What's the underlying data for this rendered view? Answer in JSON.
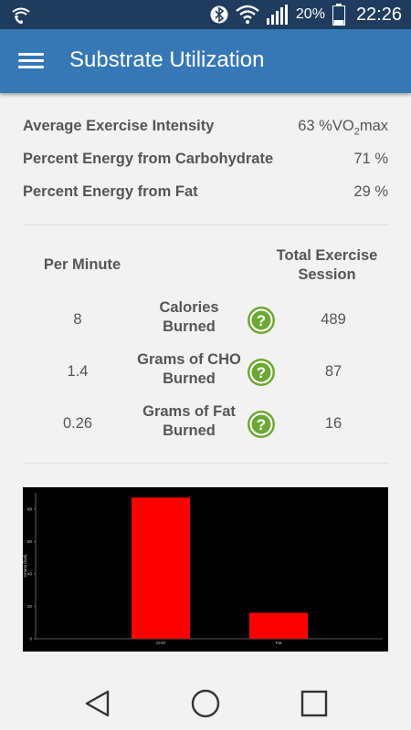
{
  "status_bar": {
    "battery_percent": "20%",
    "time": "22:26",
    "icons": [
      "wifi-call-icon",
      "bluetooth-icon",
      "wifi-icon",
      "signal-icon",
      "battery-icon"
    ]
  },
  "app_bar": {
    "title": "Substrate Utilization",
    "menu_icon": "hamburger-menu-icon"
  },
  "summary": [
    {
      "label": "Average Exercise Intensity",
      "value_prefix": "63 %VO",
      "value_sub": "2",
      "value_suffix": "max"
    },
    {
      "label": "Percent Energy from Carbohydrate",
      "value": "71 %"
    },
    {
      "label": "Percent Energy from Fat",
      "value": "29 %"
    }
  ],
  "table": {
    "col_per_minute": "Per Minute",
    "col_total_line1": "Total Exercise",
    "col_total_line2": "Session",
    "rows": [
      {
        "per_minute": "8",
        "metric_line1": "Calories",
        "metric_line2": "Burned",
        "total": "489"
      },
      {
        "per_minute": "1.4",
        "metric_line1": "Grams of CHO",
        "metric_line2": "Burned",
        "total": "87"
      },
      {
        "per_minute": "0.26",
        "metric_line1": "Grams of Fat",
        "metric_line2": "Burned",
        "total": "16"
      }
    ],
    "help_icon": "question-help-icon",
    "help_color": "#6aa832"
  },
  "chart_data": {
    "type": "bar",
    "categories": [
      "CHO",
      "Fat"
    ],
    "values": [
      87,
      16
    ],
    "ylabel": "Grams (fuel)",
    "ylim": [
      0,
      90
    ],
    "yticks": [
      0,
      20,
      40,
      60,
      80
    ],
    "bar_color": "#ff0000",
    "background": "#000000",
    "grid": false
  },
  "colors": {
    "status_bar": "#1f3c5e",
    "app_bar": "#3578b5",
    "background": "#f2f2f2"
  },
  "nav": {
    "icons": [
      "back-triangle-icon",
      "home-circle-icon",
      "recents-square-icon"
    ]
  }
}
